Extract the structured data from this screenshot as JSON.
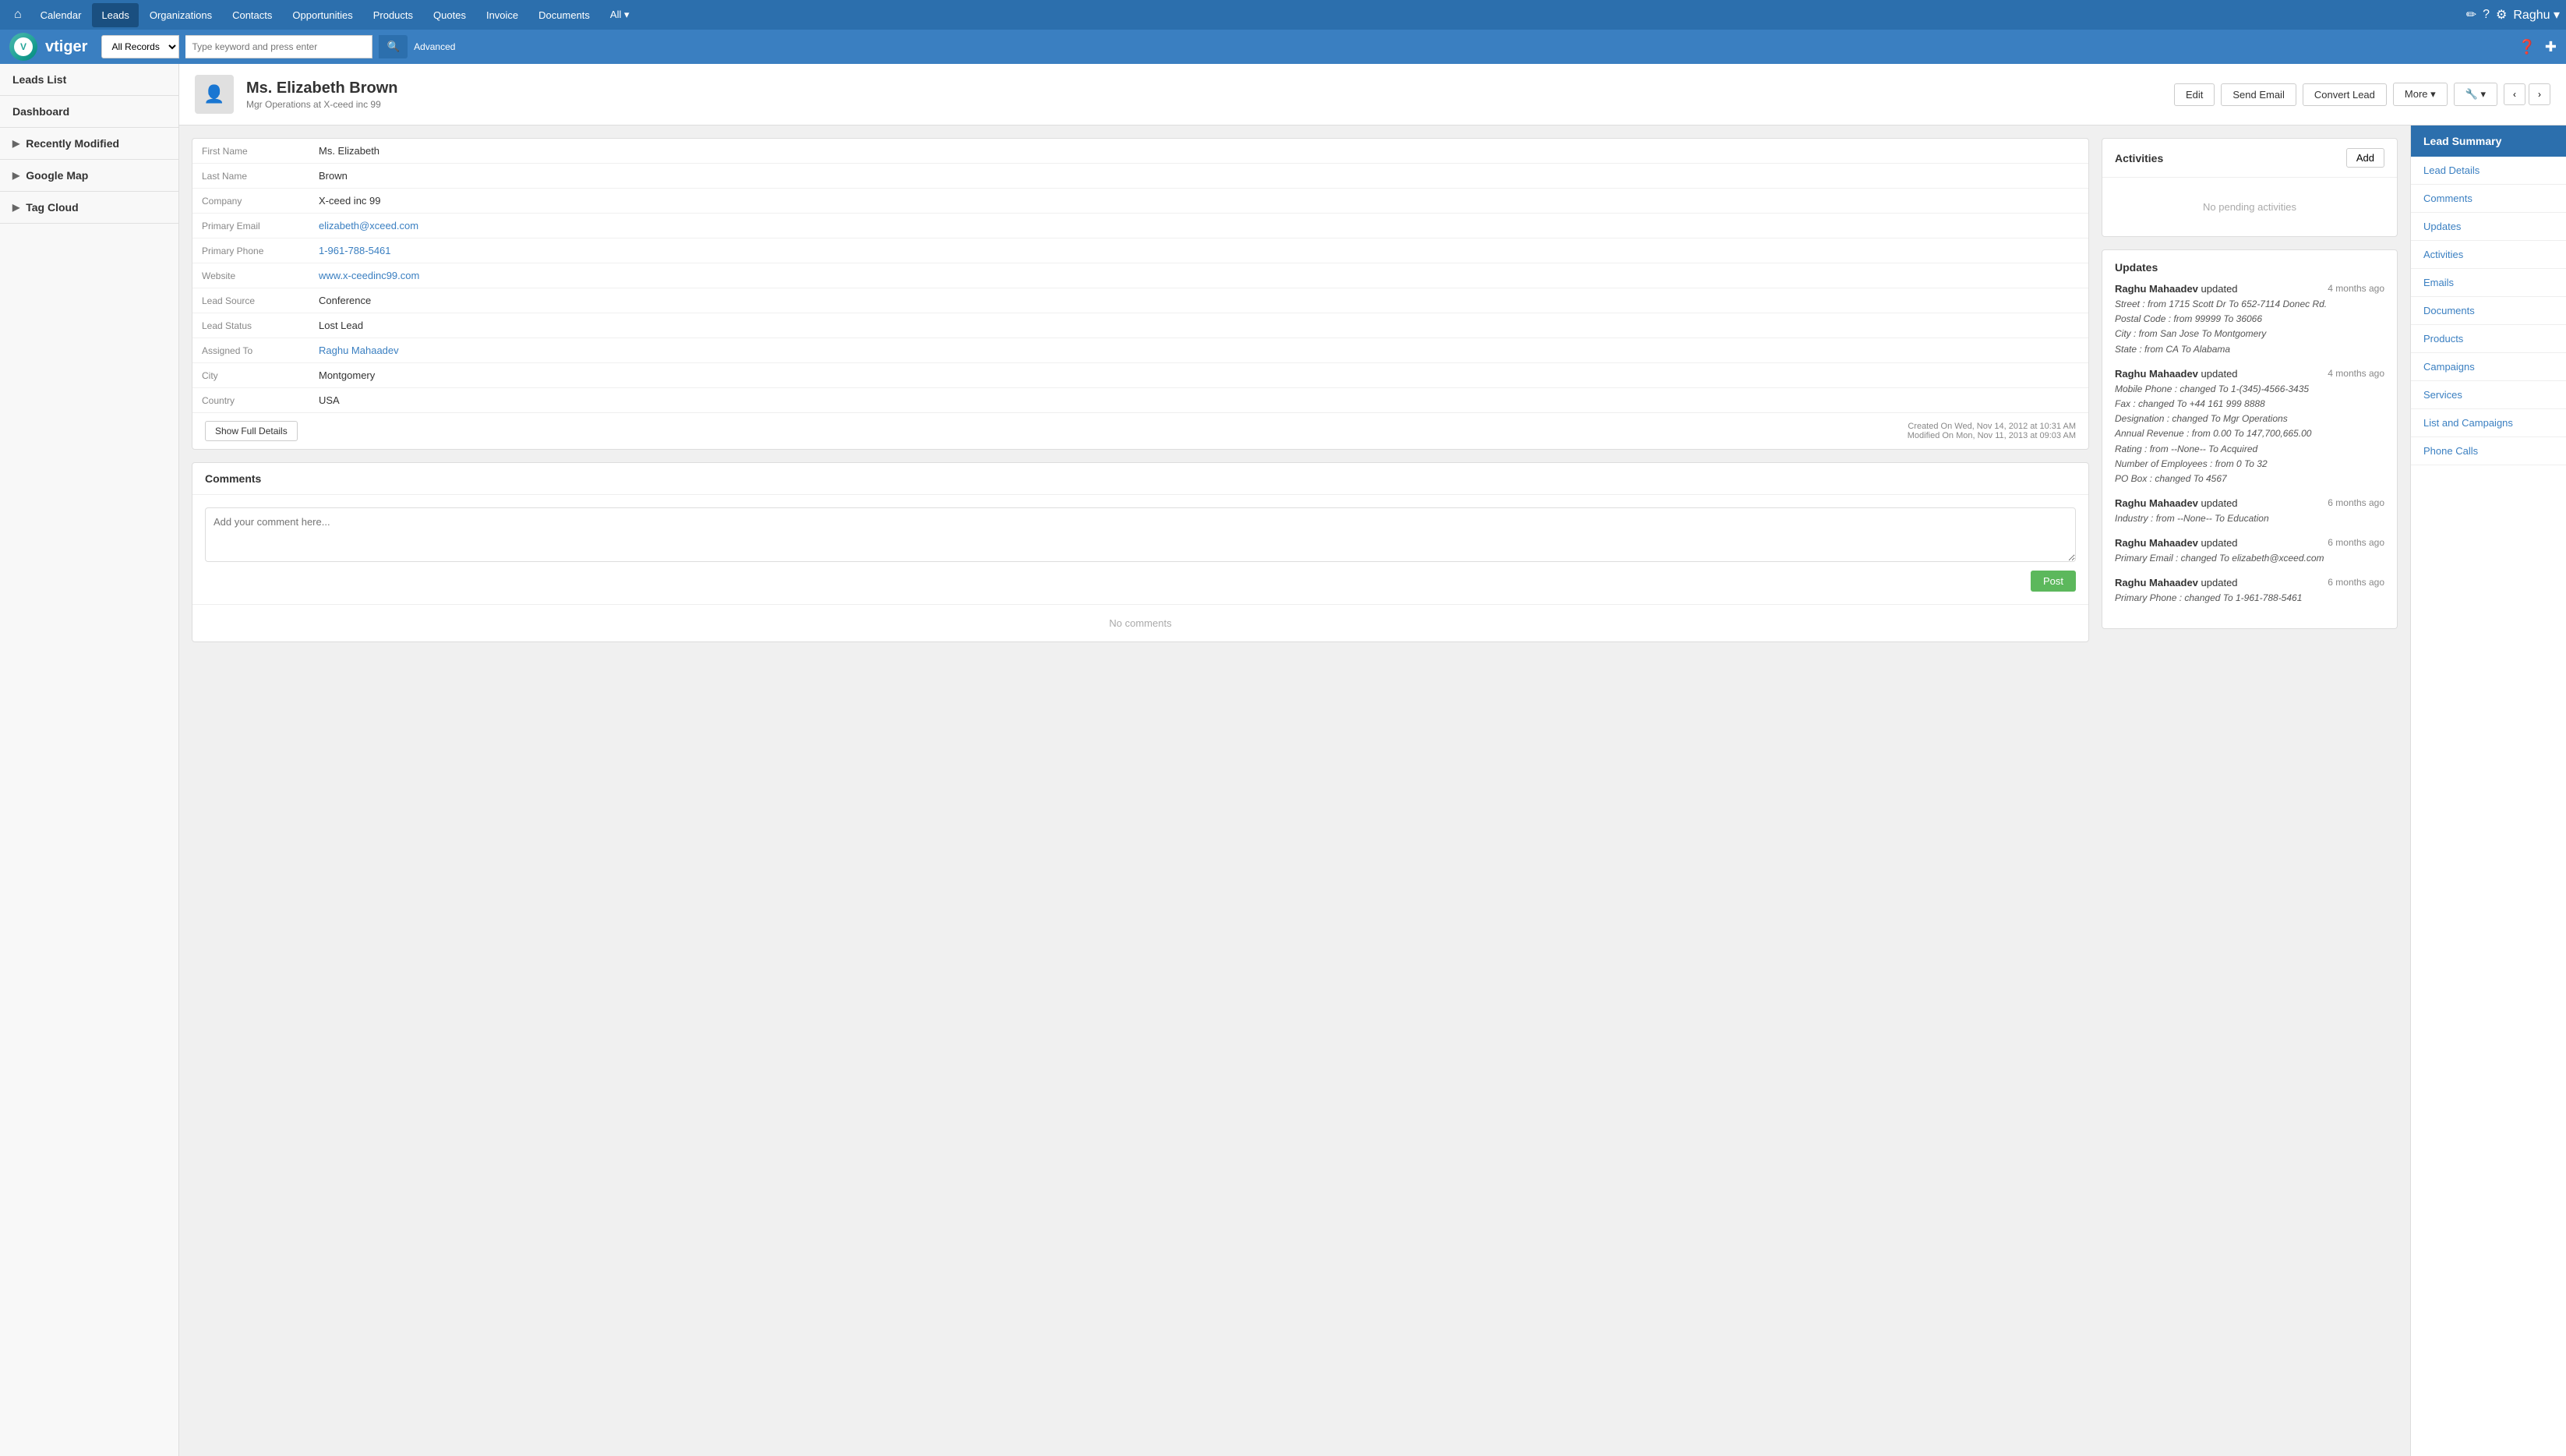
{
  "topNav": {
    "items": [
      "Calendar",
      "Leads",
      "Organizations",
      "Contacts",
      "Opportunities",
      "Products",
      "Quotes",
      "Invoice",
      "Documents",
      "All ▾"
    ],
    "activeItem": "Leads",
    "icons": [
      "✏",
      "?",
      "⚙"
    ],
    "user": "Raghu ▾"
  },
  "searchBar": {
    "logoText": "vtiger",
    "selectOption": "All Records",
    "placeholder": "Type keyword and press enter",
    "advancedLabel": "Advanced"
  },
  "sidebar": {
    "items": [
      {
        "label": "Leads List",
        "arrow": false
      },
      {
        "label": "Dashboard",
        "arrow": false
      },
      {
        "label": "Recently Modified",
        "arrow": true
      },
      {
        "label": "Google Map",
        "arrow": true
      },
      {
        "label": "Tag Cloud",
        "arrow": true
      }
    ]
  },
  "record": {
    "name": "Ms. Elizabeth Brown",
    "subtitle": "Mgr Operations at X-ceed inc 99",
    "buttons": {
      "edit": "Edit",
      "sendEmail": "Send Email",
      "convertLead": "Convert Lead",
      "more": "More ▾",
      "tools": "🔧 ▾"
    }
  },
  "details": {
    "fields": [
      {
        "label": "First Name",
        "value": "Ms. Elizabeth",
        "type": "text"
      },
      {
        "label": "Last Name",
        "value": "Brown",
        "type": "text"
      },
      {
        "label": "Company",
        "value": "X-ceed inc 99",
        "type": "text"
      },
      {
        "label": "Primary Email",
        "value": "elizabeth@xceed.com",
        "type": "link"
      },
      {
        "label": "Primary Phone",
        "value": "1-961-788-5461",
        "type": "link"
      },
      {
        "label": "Website",
        "value": "www.x-ceedinc99.com",
        "type": "link"
      },
      {
        "label": "Lead Source",
        "value": "Conference",
        "type": "text"
      },
      {
        "label": "Lead Status",
        "value": "Lost Lead",
        "type": "text"
      },
      {
        "label": "Assigned To",
        "value": "Raghu Mahaadev",
        "type": "link"
      },
      {
        "label": "City",
        "value": "Montgomery",
        "type": "text"
      },
      {
        "label": "Country",
        "value": "USA",
        "type": "text"
      }
    ],
    "createdOn": "Created On Wed, Nov 14, 2012 at 10:31 AM",
    "modifiedOn": "Modified On Mon, Nov 11, 2013 at 09:03 AM",
    "showFullDetailsBtn": "Show Full Details"
  },
  "comments": {
    "title": "Comments",
    "placeholder": "Add your comment here...",
    "postBtn": "Post",
    "noComments": "No comments"
  },
  "activities": {
    "title": "Activities",
    "addBtn": "Add",
    "noActivities": "No pending activities"
  },
  "updates": {
    "title": "Updates",
    "entries": [
      {
        "user": "Raghu Mahaadev",
        "action": "updated",
        "timeAgo": "4 months ago",
        "details": [
          "Street : from 1715 Scott Dr To 652-7114 Donec Rd.",
          "Postal Code : from 99999 To 36066",
          "City : from San Jose To Montgomery",
          "State : from CA To Alabama"
        ]
      },
      {
        "user": "Raghu Mahaadev",
        "action": "updated",
        "timeAgo": "4 months ago",
        "details": [
          "Mobile Phone : changed To 1-(345)-4566-3435",
          "Fax : changed To +44 161 999 8888",
          "Designation : changed To Mgr Operations",
          "Annual Revenue : from 0.00 To 147,700,665.00",
          "Rating : from --None-- To Acquired",
          "Number of Employees : from 0 To 32",
          "PO Box : changed To 4567"
        ]
      },
      {
        "user": "Raghu Mahaadev",
        "action": "updated",
        "timeAgo": "6 months ago",
        "details": [
          "Industry : from --None-- To Education"
        ]
      },
      {
        "user": "Raghu Mahaadev",
        "action": "updated",
        "timeAgo": "6 months ago",
        "details": [
          "Primary Email : changed To elizabeth@xceed.com"
        ]
      },
      {
        "user": "Raghu Mahaadev",
        "action": "updated",
        "timeAgo": "6 months ago",
        "details": [
          "Primary Phone : changed To 1-961-788-5461"
        ]
      }
    ]
  },
  "rightPanel": {
    "title": "Lead Summary",
    "links": [
      "Lead Details",
      "Comments",
      "Updates",
      "Activities",
      "Emails",
      "Documents",
      "Products",
      "Campaigns",
      "Services",
      "List and Campaigns",
      "Phone Calls"
    ]
  }
}
